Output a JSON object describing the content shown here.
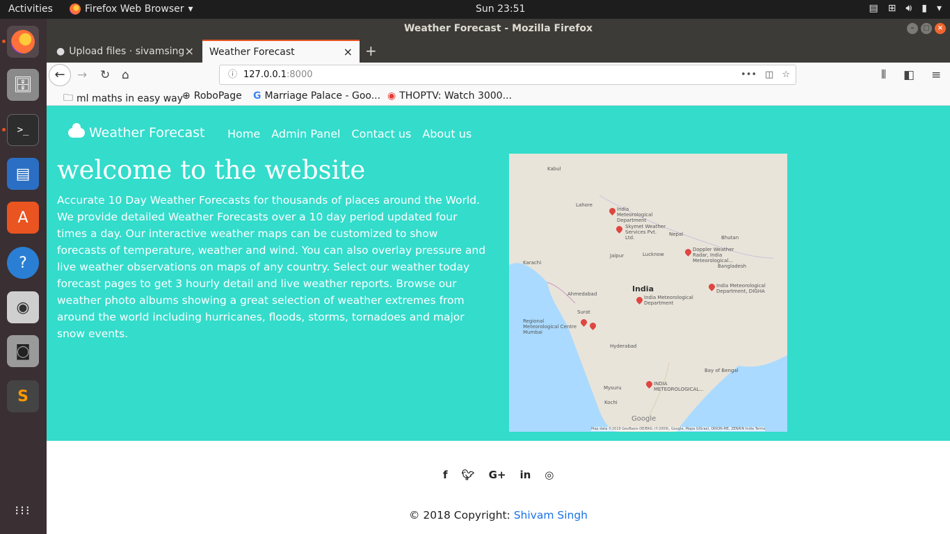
{
  "system": {
    "activities": "Activities",
    "app_menu": "Firefox Web Browser",
    "clock": "Sun 23:51"
  },
  "window": {
    "title": "Weather Forecast - Mozilla Firefox"
  },
  "tabs": [
    {
      "label": "Upload files · sivamsingh"
    },
    {
      "label": "Weather Forecast"
    }
  ],
  "url": {
    "host": "127.0.0.1",
    "port": ":8000"
  },
  "bookmarks": [
    {
      "label": "ml maths in easy way",
      "icon": "folder-icon"
    },
    {
      "label": "RoboPage",
      "icon": "globe-icon"
    },
    {
      "label": "Marriage Palace - Goo...",
      "icon": "google-icon"
    },
    {
      "label": "THOPTV: Watch 3000...",
      "icon": "thoptv-icon"
    }
  ],
  "site": {
    "brand": "Weather Forecast",
    "nav": [
      "Home",
      "Admin Panel",
      "Contact us",
      "About us"
    ],
    "heading": "welcome to the website",
    "body": "Accurate 10 Day Weather Forecasts for thousands of places around the World. We provide detailed Weather Forecasts over a 10 day period updated four times a day. Our interactive weather maps can be customized to show forecasts of temperature, weather and wind. You can also overlay pressure and live weather observations on maps of any country. Select our weather today forecast pages to get 3 hourly detail and live weather reports. Browse our weather photo albums showing a great selection of weather extremes from around the world including hurricanes, floods, storms, tornadoes and major snow events.",
    "copyright_prefix": "© 2018 Copyright:",
    "copyright_name": "Shivam Singh"
  },
  "map": {
    "country_label": "India",
    "markers": [
      "India Meteorological Department",
      "Skymet Weather Services Pvt. Ltd.",
      "Doppler Weather Radar, India Meteorological...",
      "India Meteorological Department, DIGHA",
      "India Meteorological Department",
      "Regional Meteorological Centre Mumbai",
      "INDIA METEOROLOGICAL..."
    ],
    "places": [
      "Kabul",
      "Lahore",
      "Nepal",
      "Bhutan",
      "Bangladesh",
      "Jaipur",
      "Lucknow",
      "Karachi",
      "Ahmedabad",
      "Surat",
      "Hyderabad",
      "Mysuru",
      "Kochi",
      "Bay of Bengal"
    ],
    "google": "Google",
    "attribution": "Map data ©2019 GeoBasis-DE/BKG (©2009), Google, Mapa GISrael, ORION-ME, ZENRIN   India   Terms"
  },
  "colors": {
    "hero_bg": "#33dccb",
    "link": "#1a73e8",
    "accent": "#e95420"
  }
}
